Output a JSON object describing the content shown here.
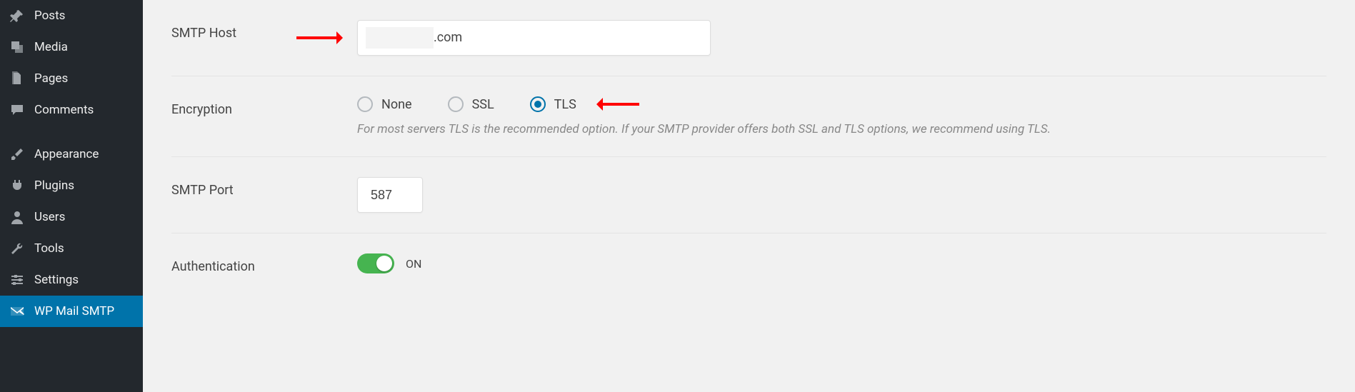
{
  "sidebar": {
    "items": [
      {
        "label": "Posts"
      },
      {
        "label": "Media"
      },
      {
        "label": "Pages"
      },
      {
        "label": "Comments"
      },
      {
        "label": "Appearance"
      },
      {
        "label": "Plugins"
      },
      {
        "label": "Users"
      },
      {
        "label": "Tools"
      },
      {
        "label": "Settings"
      },
      {
        "label": "WP Mail SMTP"
      }
    ]
  },
  "form": {
    "smtp_host": {
      "label": "SMTP Host",
      "value": "",
      "domain_suffix": ".com"
    },
    "encryption": {
      "label": "Encryption",
      "options": {
        "none": "None",
        "ssl": "SSL",
        "tls": "TLS"
      },
      "selected": "tls",
      "help": "For most servers TLS is the recommended option. If your SMTP provider offers both SSL and TLS options, we recommend using TLS."
    },
    "smtp_port": {
      "label": "SMTP Port",
      "value": "587"
    },
    "auth": {
      "label": "Authentication",
      "status": "ON",
      "enabled": true
    }
  }
}
